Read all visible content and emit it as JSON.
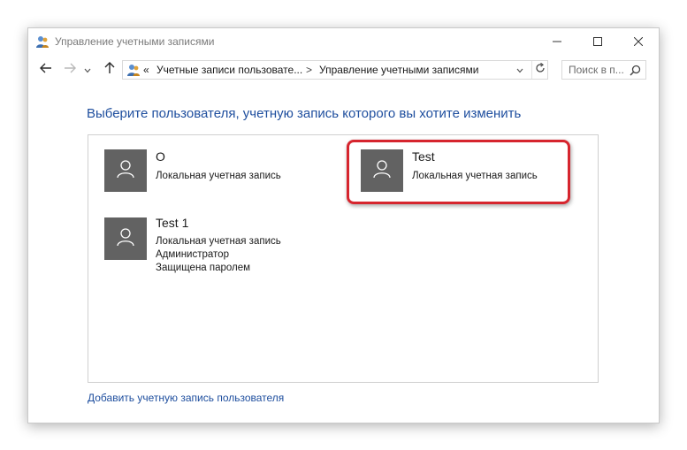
{
  "window": {
    "title": "Управление учетными записями",
    "title_icon": "users-icon",
    "controls": [
      "minimize-icon",
      "maximize-icon",
      "close-icon"
    ]
  },
  "navigation": {
    "back_icon": "arrow-left-icon",
    "forward_icon": "arrow-right-icon",
    "up_icon": "arrow-up-icon",
    "address": {
      "prefix": "«",
      "segments": [
        "Учетные записи пользовате...",
        "Управление учетными записями"
      ],
      "separator": ">"
    },
    "search_placeholder": "Поиск в п..."
  },
  "main": {
    "heading": "Выберите пользователя, учетную запись которого вы хотите изменить",
    "accounts": [
      {
        "name": "O",
        "details": [
          "Локальная учетная запись"
        ],
        "highlighted": false
      },
      {
        "name": "Test",
        "details": [
          "Локальная учетная запись"
        ],
        "highlighted": true
      },
      {
        "name": "Test 1",
        "details": [
          "Локальная учетная запись",
          "Администратор",
          "Защищена паролем"
        ],
        "highlighted": false
      }
    ],
    "add_account_link": "Добавить учетную запись пользователя"
  },
  "colors": {
    "accent_text": "#1e4e9e",
    "avatar_bg": "#626262",
    "highlight_border": "#d6252e"
  }
}
